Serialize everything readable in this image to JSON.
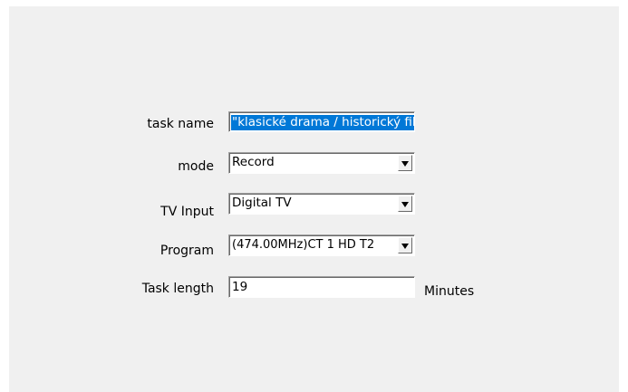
{
  "form": {
    "task_name": {
      "label": "task name",
      "value": "\"klasické drama / historický fil"
    },
    "mode": {
      "label": "mode",
      "value": "Record"
    },
    "tv_input": {
      "label": "TV Input",
      "value": "Digital TV"
    },
    "program": {
      "label": "Program",
      "value": "(474.00MHz)CT 1 HD T2"
    },
    "task_length": {
      "label": "Task length",
      "value": "19",
      "unit": "Minutes"
    }
  },
  "icons": {
    "dropdown": "chevron-down-icon"
  }
}
